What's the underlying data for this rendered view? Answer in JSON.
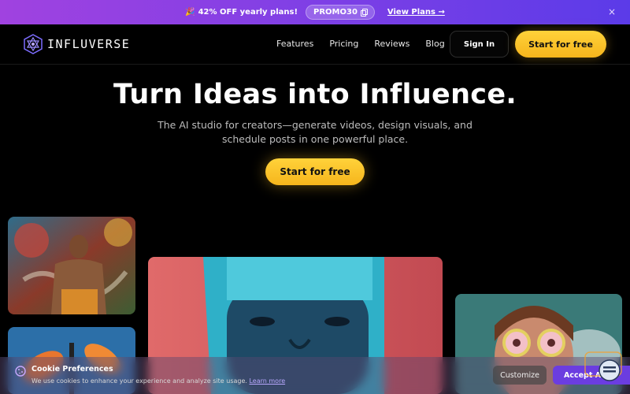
{
  "promo": {
    "emoji": "🎉",
    "text": "42% OFF yearly plans!",
    "code": "PROMO30",
    "link": "View Plans →",
    "close": "×"
  },
  "nav": {
    "brand": "INFLUVERSE",
    "links": [
      "Features",
      "Pricing",
      "Reviews",
      "Blog"
    ],
    "signin": "Sign In",
    "cta": "Start for free"
  },
  "hero": {
    "title": "Turn Ideas into Influence.",
    "subtitle": "The AI studio for creators—generate videos, design visuals, and schedule posts in one powerful place.",
    "cta": "Start for free"
  },
  "gallery": {
    "images": [
      "street-portrait-mural",
      "orange-balloons",
      "blue-haired-portrait",
      "woman-with-glasses"
    ]
  },
  "cookie": {
    "title": "Cookie Preferences",
    "text": "We use cookies to enhance your experience and analyze site usage.",
    "learn_more": "Learn more",
    "customize": "Customize",
    "accept": "Accept All"
  },
  "colors": {
    "accent_yellow": "#ffc828",
    "promo_purple": "#7b3fe6",
    "accept_purple": "#6b3de0"
  }
}
